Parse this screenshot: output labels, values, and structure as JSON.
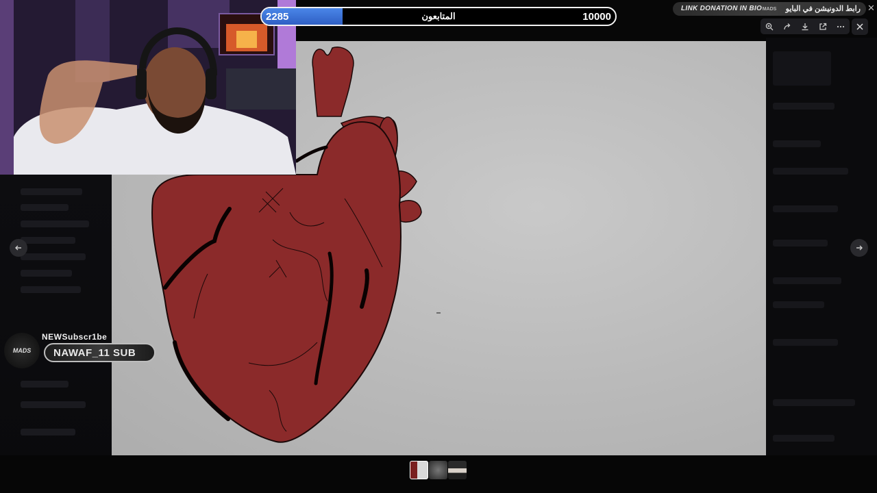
{
  "follower_goal": {
    "current": "2285",
    "label": "المتابعون",
    "goal": "10000",
    "progress_fraction": 0.2285,
    "fill_color": "#3a6fd8"
  },
  "donation_banner": {
    "text_en": "LINK DONATION IN BIO",
    "logo_text": "MADS",
    "text_ar": "رابط الدونيشن في البايو",
    "close_icon": "close-icon"
  },
  "image_viewer": {
    "toolbar_icons": [
      "zoom-in-icon",
      "share-icon",
      "download-icon",
      "open-external-icon",
      "more-icon"
    ],
    "close_icon": "close-icon",
    "prev_icon": "arrow-left-icon",
    "next_icon": "arrow-right-icon"
  },
  "subscriber_alert": {
    "title": "NEWSubscr1be",
    "name": "NAWAF_11 SUB",
    "badge_text": "MADS"
  },
  "thumbnails": [
    "thumb-heart-drawing",
    "thumb-logo",
    "thumb-webcam"
  ],
  "colors": {
    "heart_fill": "#8b2a2a",
    "canvas_bg": "#bfbfbf",
    "accent_blue": "#3a6fd8"
  }
}
